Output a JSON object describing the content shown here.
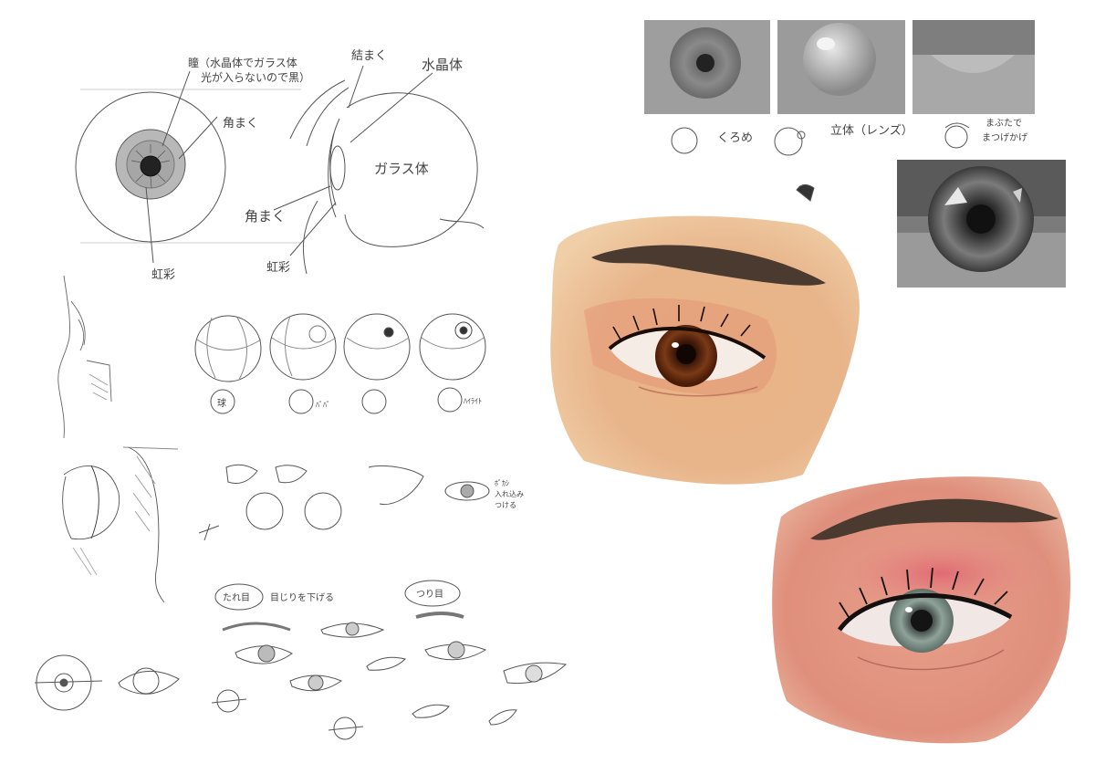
{
  "anatomy": {
    "pupil_note_line1": "瞳（水晶体でガラス体",
    "pupil_note_line2": "光が入らないので黒）",
    "cornea": "角まく",
    "iris": "虹彩",
    "conjunctiva": "結まく",
    "lens": "水晶体",
    "vitreous": "ガラス体",
    "cornea_side": "角まく",
    "iris_side": "虹彩"
  },
  "sphere_studies": {
    "sphere": "球",
    "pupil_small": "ﾊﾟﾊﾟ",
    "highlight_small": "ﾊｲﾗｲﾄ"
  },
  "side_note": {
    "line1": "ﾎﾞｶｼ",
    "line2": "入れ込み",
    "line3": "つける"
  },
  "eye_types": {
    "droopy": "たれ目",
    "droopy_note": "目じりを下げる",
    "upturned": "つり目"
  },
  "rendering_steps": {
    "step1": "くろめ",
    "step2": "立体（レンズ）",
    "step3_line1": "まぶたで",
    "step3_line2": "まつげかげ"
  },
  "colors": {
    "skin_warm": "#e6ad80",
    "skin_pink": "#e59986",
    "lid_red": "#d8646c",
    "brow": "#4a3a30",
    "iris_brown": "#6b2e12",
    "iris_green": "#7f938a",
    "tile_gray": "#9a9a9a",
    "pencil": "#555555"
  }
}
